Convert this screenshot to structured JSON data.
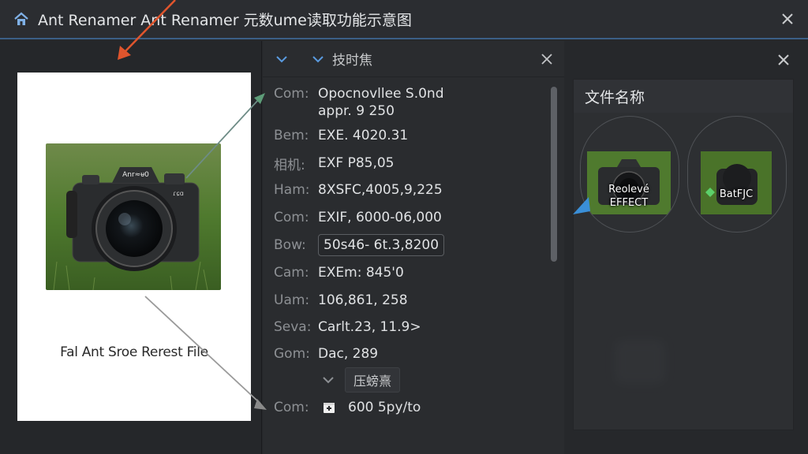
{
  "window": {
    "title": "Ant Renamer Ant Renamer 元数ume读取功能示意图",
    "app_icon": "home-icon",
    "close_icon": "close-icon"
  },
  "preview": {
    "filename": "Fal Ant Sroe Rerest File",
    "camera_badge": "Anr≈ᵾ0",
    "camera_side": "ɾɕɑ"
  },
  "metadata": {
    "header_label": "技时焦",
    "rows": [
      {
        "key": "Com:",
        "value_line1": "Opocnovllee  S.0nd",
        "value_line2": "appr. 9 250"
      },
      {
        "key": "Bem:",
        "value": "EXE. 4020.31"
      },
      {
        "key": "相机:",
        "value": "EXF P85,05"
      },
      {
        "key": "Ham:",
        "value": "8XSFC,4005,9,225"
      },
      {
        "key": "Com:",
        "value": "EXIF, 6000-06,000"
      },
      {
        "key": "Bow:",
        "value": "50s46- 6t.3,8200"
      },
      {
        "key": "Cam:",
        "value": "EXEm: 845'0"
      },
      {
        "key": "Uam:",
        "value": "106,861, 258"
      },
      {
        "key": "Seva:",
        "value": "Carlt.23, 11.9>"
      },
      {
        "key": "Gom:",
        "value": "Dac, 289"
      }
    ],
    "sub_button": "压螃熹",
    "last_row": {
      "key": "Com:",
      "value": "600 5py/to"
    }
  },
  "thumbnails": {
    "header": "文件名称",
    "items": [
      {
        "label_line1": "Reolevé",
        "label_line2": "EFFECT"
      },
      {
        "label_line1": "BatFJC",
        "label_line2": ""
      }
    ]
  },
  "colors": {
    "accent_line": "#3b5f86",
    "arrow_orange": "#e0552d",
    "arrow_green": "#5d9c78",
    "arrow_blue": "#3a8fd8"
  }
}
